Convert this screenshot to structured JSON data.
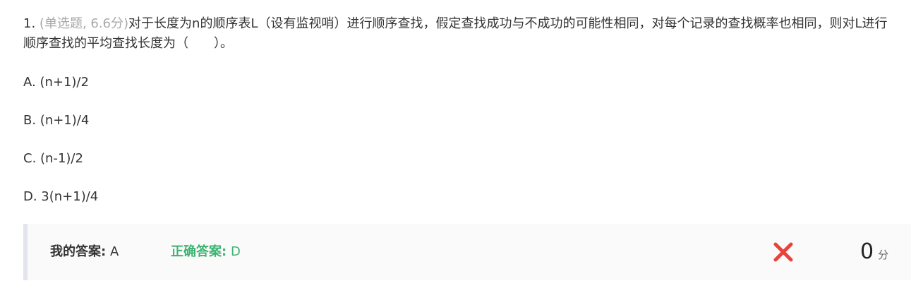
{
  "question": {
    "number": "1.",
    "meta": "(单选题, 6.6分)",
    "text": "对于长度为n的顺序表L（设有监视哨）进行顺序查找，假定查找成功与不成功的可能性相同，对每个记录的查找概率也相同，则对L进行顺序查找的平均查找长度为（　　）。"
  },
  "options": [
    {
      "label": "A. (n+1)/2"
    },
    {
      "label": "B. (n+1)/4"
    },
    {
      "label": "C. (n-1)/2"
    },
    {
      "label": "D. 3(n+1)/4"
    }
  ],
  "result": {
    "my_answer_label": "我的答案:",
    "my_answer_value": "A",
    "correct_answer_label": "正确答案:",
    "correct_answer_value": "D",
    "status_icon": "cross-icon",
    "score": "0",
    "score_unit": "分"
  },
  "colors": {
    "meta": "#a8a8a8",
    "correct": "#3cb371",
    "wrong": "#e8423b"
  }
}
